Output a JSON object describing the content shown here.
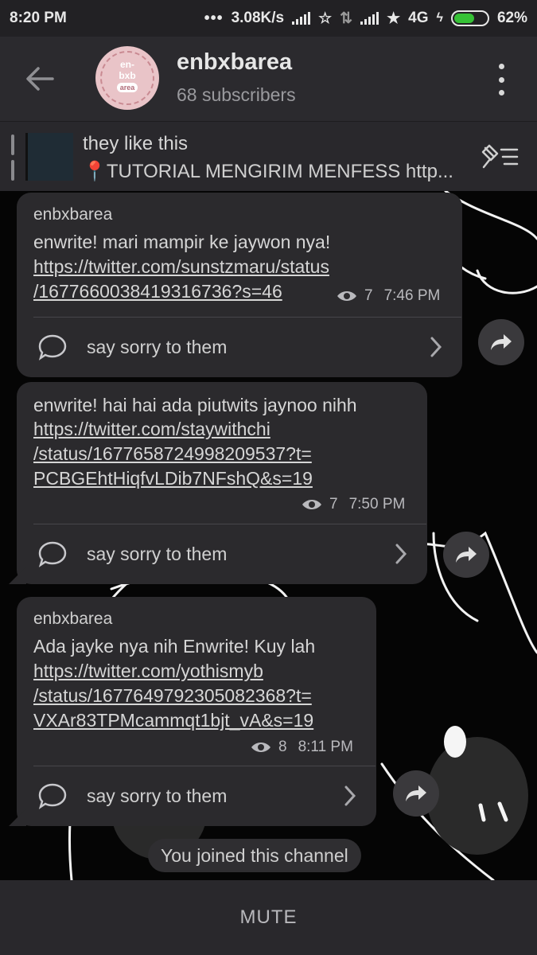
{
  "statusbar": {
    "time": "8:20 PM",
    "network_speed": "3.08K/s",
    "network_type": "4G",
    "battery": "62%",
    "battery_level": 0.62,
    "icons": [
      "dots-icon",
      "signal-icon",
      "star-icon",
      "data-arrows-icon",
      "signal-icon",
      "star-icon",
      "charging-icon",
      "battery-icon"
    ]
  },
  "header": {
    "channel_name": "enbxbarea",
    "subscribers": "68 subscribers",
    "avatar_text": "en-\nbxb",
    "avatar_badge": "area"
  },
  "pinned": {
    "title": "they like this",
    "text": "📍TUTORIAL MENGIRIM MENFESS  http..."
  },
  "messages": [
    {
      "author": "enbxbarea",
      "text": "enwrite! mari mampir ke jaywon nya!",
      "link_lines": [
        "https://twitter.com/sunstzmaru/status",
        "/1677660038419316736?s=46"
      ],
      "views": "7",
      "time": "7:46 PM",
      "comment_label": "say sorry to them"
    },
    {
      "author": "",
      "text": "enwrite! hai hai ada piutwits jaynoo nihh",
      "link_lines": [
        "https://twitter.com/staywithchi",
        "/status/1677658724998209537?t=",
        "PCBGEhtHiqfvLDib7NFshQ&s=19"
      ],
      "views": "7",
      "time": "7:50 PM",
      "comment_label": "say sorry to them"
    },
    {
      "author": "enbxbarea",
      "text": "Ada jayke nya nih Enwrite! Kuy lah",
      "link_lines": [
        "https://twitter.com/yothismyb",
        "/status/1677649792305082368?t=",
        "VXAr83TPMcammqt1bjt_vA&s=19"
      ],
      "views": "8",
      "time": "8:11 PM",
      "comment_label": "say sorry to them"
    }
  ],
  "service_message": "You joined this channel",
  "bottom": {
    "mute_label": "MUTE"
  },
  "colors": {
    "bubble": "#2b2a2d",
    "header": "#2b2a2e",
    "background": "#050505",
    "battery_fill": "#36c236"
  }
}
